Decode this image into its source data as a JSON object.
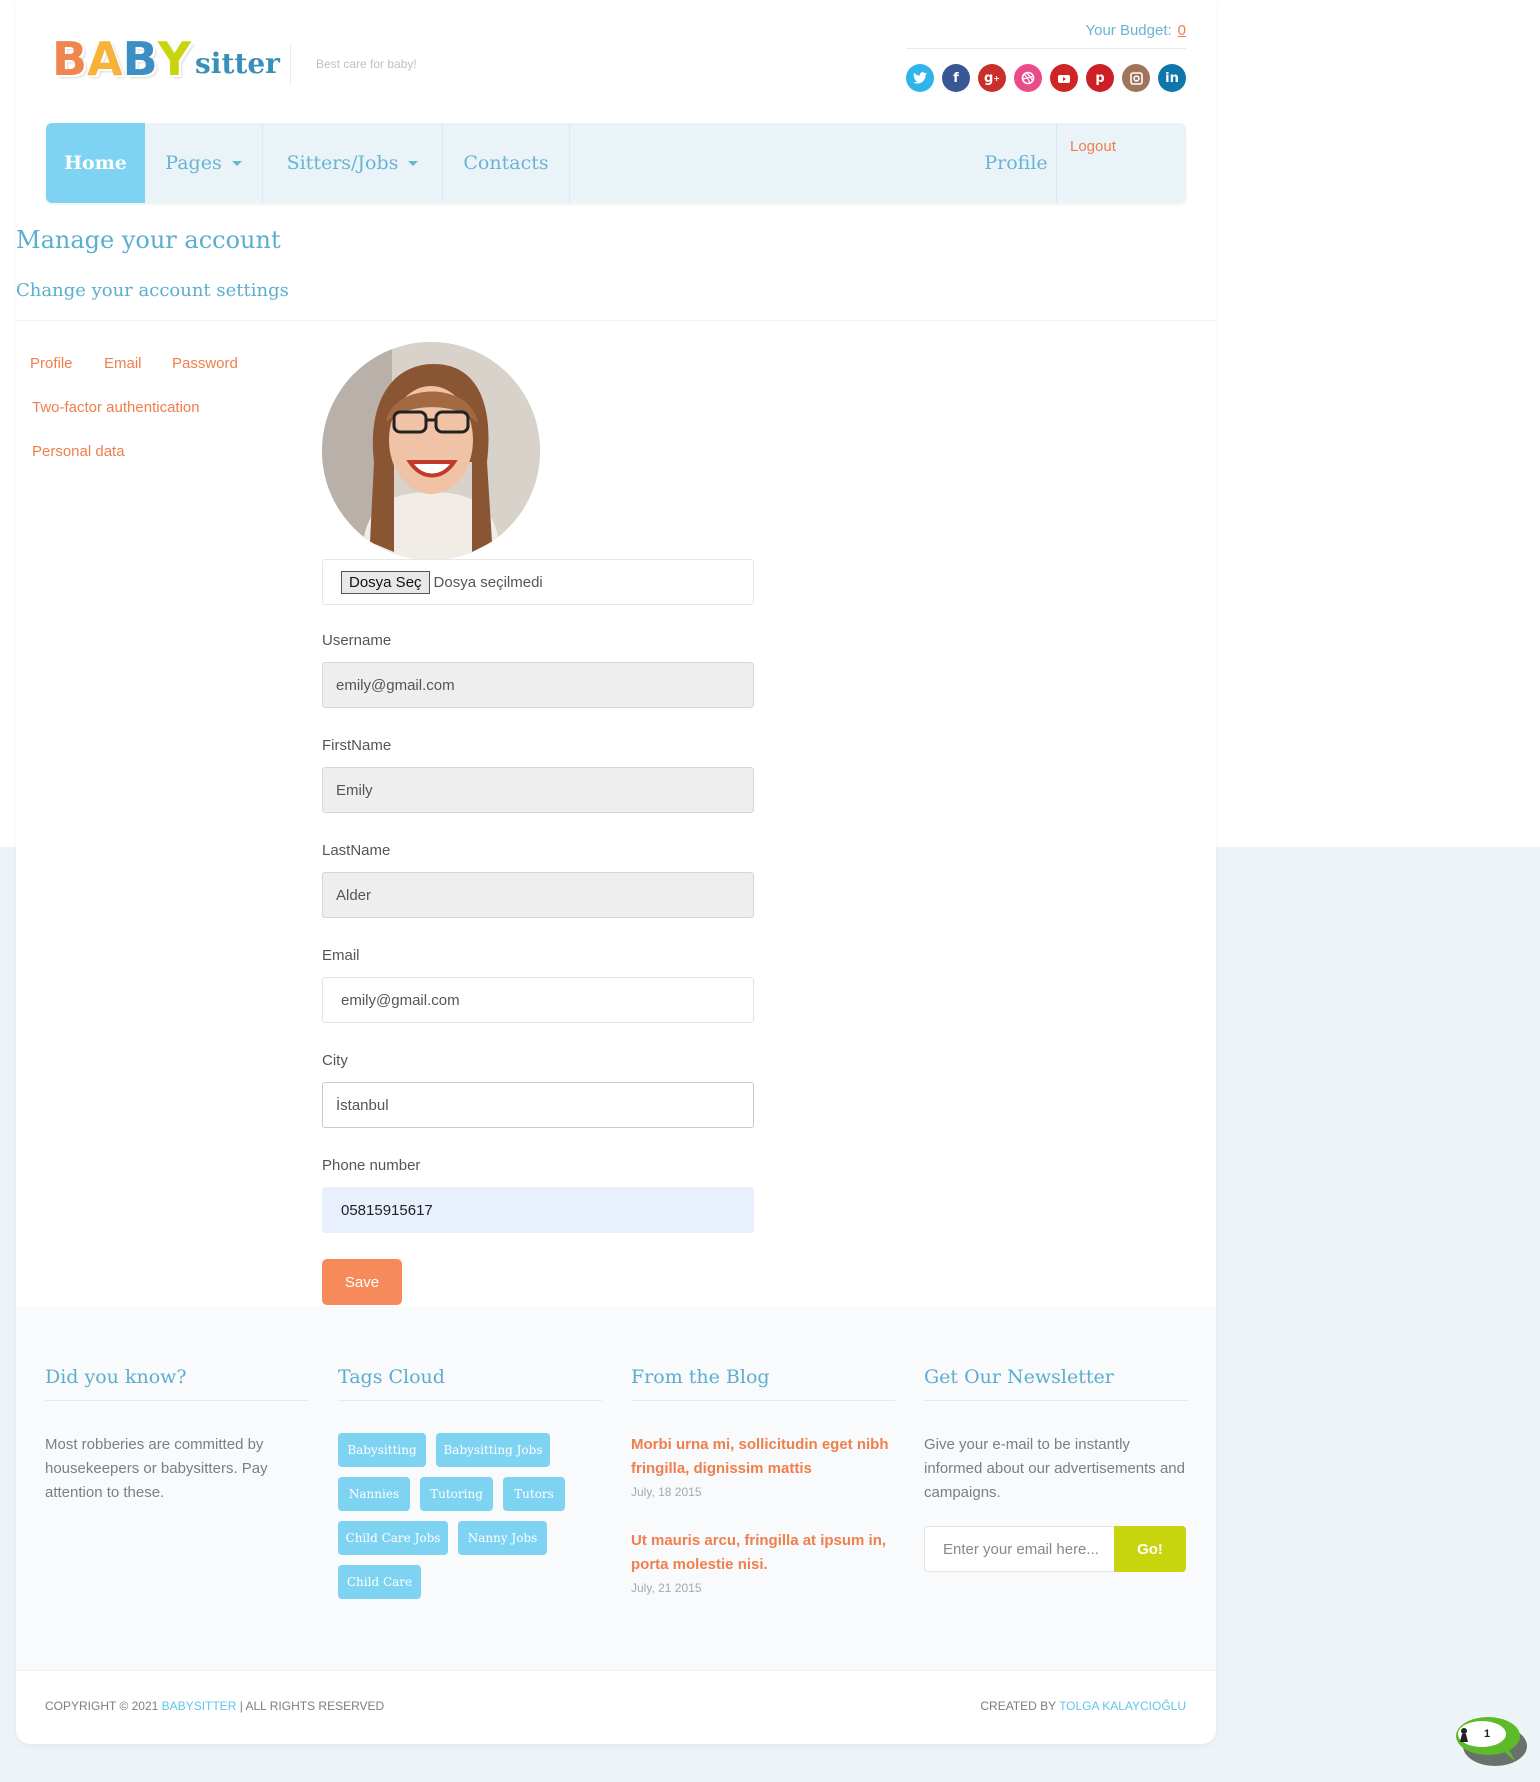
{
  "header": {
    "logo": {
      "b1": "B",
      "a": "A",
      "b2": "B",
      "y": "Y",
      "sitter": "sitter"
    },
    "tagline": "Best care for baby!",
    "budget_label": "Your Budget:",
    "budget_value": "0",
    "social_icons": [
      "twitter-icon",
      "facebook-icon",
      "google-plus-icon",
      "dribbble-icon",
      "youtube-icon",
      "pinterest-icon",
      "instagram-icon",
      "linkedin-icon"
    ]
  },
  "nav": {
    "home": "Home",
    "pages": "Pages",
    "sitters_jobs": "Sitters/Jobs",
    "contacts": "Contacts",
    "profile": "Profile",
    "logout": "Logout"
  },
  "page": {
    "title": "Manage your account",
    "subtitle": "Change your account settings"
  },
  "side_menu": {
    "profile": "Profile",
    "email": "Email",
    "password": "Password",
    "two_factor": "Two-factor authentication",
    "personal_data": "Personal data"
  },
  "form": {
    "file_button": "Dosya Seç",
    "file_status": "Dosya seçilmedi",
    "username_label": "Username",
    "username_value": "emily@gmail.com",
    "firstname_label": "FirstName",
    "firstname_value": "Emily",
    "lastname_label": "LastName",
    "lastname_value": "Alder",
    "email_label": "Email",
    "email_value": "emily@gmail.com",
    "city_label": "City",
    "city_value": "İstanbul",
    "phone_label": "Phone number",
    "phone_value": "05815915617",
    "save_label": "Save"
  },
  "footer": {
    "did_you_know_title": "Did you know?",
    "did_you_know_text": "Most robberies are committed by housekeepers or babysitters. Pay attention to these.",
    "tags_title": "Tags Cloud",
    "tags": [
      "Babysitting",
      "Babysitting Jobs",
      "Nannies",
      "Tutoring",
      "Tutors",
      "Child Care Jobs",
      "Nanny Jobs",
      "Child Care"
    ],
    "blog_title": "From the Blog",
    "blog_posts": [
      {
        "title": "Morbi urna mi, sollicitudin eget nibh fringilla, dignissim mattis",
        "date": "July, 18 2015"
      },
      {
        "title": "Ut mauris arcu, fringilla at ipsum in, porta molestie nisi.",
        "date": "July, 21 2015"
      }
    ],
    "newsletter_title": "Get Our Newsletter",
    "newsletter_text": "Give your e-mail to be instantly informed about our advertisements and campaigns.",
    "newsletter_placeholder": "Enter your email here...",
    "newsletter_button": "Go!",
    "copyright_prefix": "COPYRIGHT © 2021",
    "copyright_brand": "BABYSITTER",
    "copyright_suffix": "|  ALL RIGHTS RESERVED",
    "created_prefix": "CREATED BY",
    "created_author": "TOLGA KALAYCIOĞLU"
  },
  "chat_widget": {
    "count": "1"
  },
  "colors": {
    "accent_blue": "#7fd3f2",
    "accent_orange": "#ef7f4d",
    "newsletter_green": "#c7d40e",
    "logo_b1": "#f0864f",
    "logo_a": "#f7b23a",
    "logo_b2": "#3b8fc4",
    "logo_y": "#c7d40e"
  }
}
